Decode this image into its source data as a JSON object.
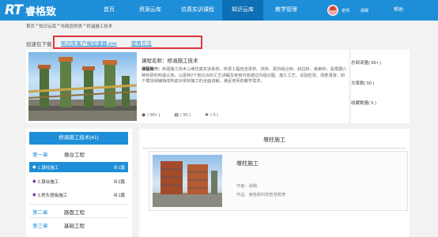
{
  "header": {
    "logo_rt": "RT",
    "logo_text": "睿格致",
    "nav": [
      {
        "label": "首页"
      },
      {
        "label": "资源云库"
      },
      {
        "label": "仿真实训课程"
      },
      {
        "label": "知识云库",
        "active": true
      },
      {
        "label": "教学管理"
      }
    ],
    "user_label": "老师",
    "user_name": "胡偶",
    "help": "帮助",
    "colors": {
      "primary": "#1e8ed8",
      "active": "#0d6fb5"
    }
  },
  "breadcrumb": [
    "首页",
    ">",
    "知识云库",
    ">",
    "市政道桥类",
    ">",
    "桥涵施工技术"
  ],
  "download": {
    "label": "加速包下载",
    "links": [
      "知识库客户端加速器.exe",
      "使用方法"
    ],
    "highlight_color": "#e0353f"
  },
  "course": {
    "title": "课程名称：桥涵施工技术",
    "intro_label": "课程简介：",
    "intro_text": "桥涵施工技术三维仿真实训系统，桥梁工程包含梁桥、拱桥、梁拱组合桥、斜拉桥、悬索桥，是根据六种桥梁的构造认知，以梁桥2个知识点的工艺讲解及考核内容通过内组识图、施工工艺、试验检测、场景漫游，四个模块相辅相成构成对梁桥施工的全面讲解，满足老师的教学需求。",
    "stats": [
      {
        "icon": "eye-icon",
        "glyph": "◉",
        "value": "( 99+ )"
      },
      {
        "icon": "document-icon",
        "glyph": "▤",
        "value": "( 50 )"
      },
      {
        "icon": "star-icon",
        "glyph": "★",
        "value": "( 5 )"
      }
    ]
  },
  "side_stats": [
    {
      "label": "总阅读量",
      "value": "( 99+ )"
    },
    {
      "label": "文章数",
      "value": "( 50 )"
    },
    {
      "label": "收藏数量",
      "value": "( 5 )"
    }
  ],
  "menu": {
    "header": "桥涵施工技术(41)",
    "chapters": [
      {
        "num": "第一章",
        "name": "墩台工程"
      },
      {
        "num": "第二章",
        "name": "路面工程"
      },
      {
        "num": "第三章",
        "name": "基础工程"
      }
    ],
    "lessons": [
      {
        "label": "1.墩柱施工",
        "count": "1篇",
        "active": true
      },
      {
        "label": "2.墩台施工",
        "count": "2篇",
        "active": false
      },
      {
        "label": "3.桥头搭板施工",
        "count": "1篇",
        "active": false
      }
    ]
  },
  "content": {
    "section_title": "墩柱施工",
    "item": {
      "title": "墩柱施工",
      "author": "作者：胡偶",
      "source": "作品：睿格致科技智慧教育"
    }
  }
}
